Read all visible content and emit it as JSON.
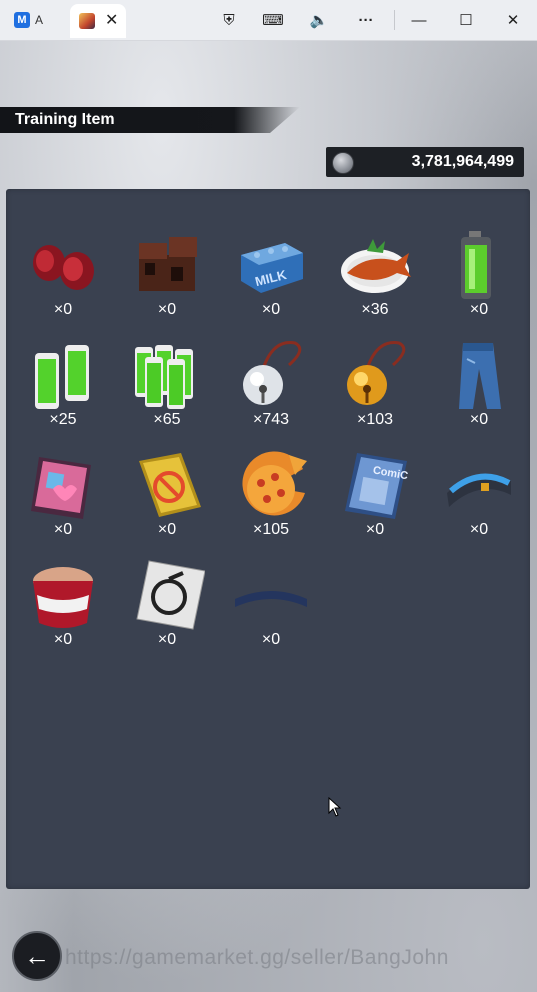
{
  "browser": {
    "tab1_label": "A",
    "tab1_icon_text": "M",
    "tab2_close": "✕",
    "icons": [
      "shield-clock-icon",
      "keyboard-icon",
      "volume-icon",
      "more-icon",
      "minimize-icon",
      "maximize-icon",
      "close-icon"
    ],
    "glyphs": {
      "shield": "⛨",
      "keyboard": "⌨",
      "volume": "🔈",
      "more": "···",
      "minimize": "—",
      "maximize": "☐",
      "close": "✕"
    }
  },
  "header": {
    "title": "Training Item"
  },
  "currency": {
    "value": "3,781,964,499",
    "icon": "coin-icon"
  },
  "items": [
    {
      "name": "dumbbells",
      "count": "×0"
    },
    {
      "name": "bricks",
      "count": "×0"
    },
    {
      "name": "milk",
      "count": "×0"
    },
    {
      "name": "fish-dish",
      "count": "×36"
    },
    {
      "name": "battery",
      "count": "×0"
    },
    {
      "name": "battery-pack",
      "count": "×25"
    },
    {
      "name": "battery-crate",
      "count": "×65"
    },
    {
      "name": "silver-bell",
      "count": "×743"
    },
    {
      "name": "gold-bell",
      "count": "×103"
    },
    {
      "name": "jeans",
      "count": "×0"
    },
    {
      "name": "magazine",
      "count": "×0"
    },
    {
      "name": "book",
      "count": "×0"
    },
    {
      "name": "pizza",
      "count": "×105"
    },
    {
      "name": "comic",
      "count": "×0"
    },
    {
      "name": "wristband",
      "count": "×0"
    },
    {
      "name": "cup-noodle",
      "count": "×0"
    },
    {
      "name": "card",
      "count": "×0"
    },
    {
      "name": "headband",
      "count": "×0"
    }
  ],
  "watermark": "https://gamemarket.gg/seller/BangJohn",
  "back_label": "←"
}
